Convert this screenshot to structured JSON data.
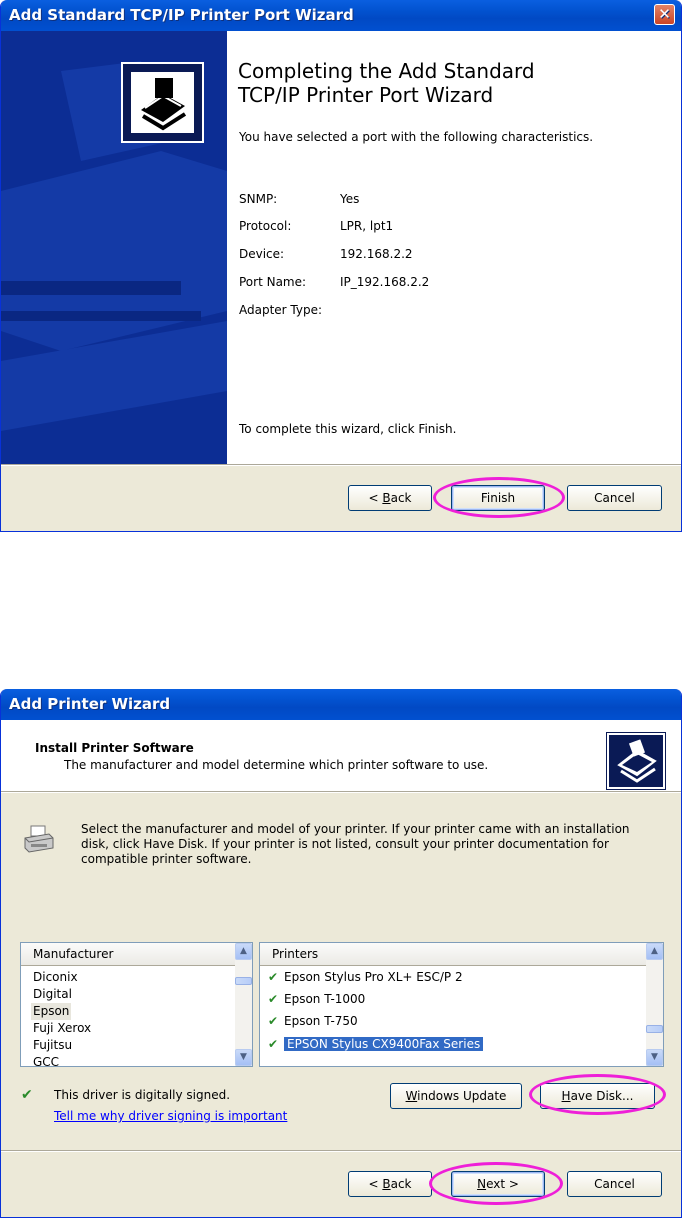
{
  "wizard1": {
    "title": "Add Standard TCP/IP Printer Port Wizard",
    "close_glyph": "✕",
    "heading_line1": "Completing the Add Standard",
    "heading_line2": "TCP/IP Printer Port Wizard",
    "intro": "You have selected a port with the following characteristics.",
    "details": [
      {
        "label": "SNMP:",
        "value": "Yes"
      },
      {
        "label": "Protocol:",
        "value": "LPR, lpt1"
      },
      {
        "label": "Device:",
        "value": "192.168.2.2"
      },
      {
        "label": "Port Name:",
        "value": "IP_192.168.2.2"
      },
      {
        "label": "Adapter Type:",
        "value": ""
      }
    ],
    "footer_text": "To complete this wizard, click Finish.",
    "buttons": {
      "back": "< Back",
      "back_accel": "B",
      "finish": "Finish",
      "cancel": "Cancel"
    },
    "sidebar_color": "#0c2d94"
  },
  "wizard2": {
    "title": "Add Printer Wizard",
    "header_title": "Install Printer Software",
    "header_subtitle": "The manufacturer and model determine which printer software to use.",
    "instructions": "Select the manufacturer and model of your printer. If your printer came with an installation disk, click Have Disk. If your printer is not listed, consult your printer documentation for compatible printer software.",
    "manufacturer_header": "Manufacturer",
    "manufacturers": [
      "Diconix",
      "Digital",
      "Epson",
      "Fuji Xerox",
      "Fujitsu",
      "GCC"
    ],
    "selected_manufacturer": "Epson",
    "printers_header": "Printers",
    "printers": [
      "Epson Stylus Pro XL+ ESC/P 2",
      "Epson T-1000",
      "Epson T-750",
      "EPSON Stylus CX9400Fax Series"
    ],
    "selected_printer": "EPSON Stylus CX9400Fax Series",
    "signed_text": "This driver is digitally signed.",
    "signing_link": "Tell me why driver signing is important",
    "buttons": {
      "windows_update": "Windows Update",
      "have_disk": "Have Disk...",
      "back": "< Back",
      "next": "Next >",
      "cancel": "Cancel"
    },
    "highlight_color": "#316ac5",
    "link_color": "#0000ff"
  },
  "annotation_color": "#ee1fd8"
}
